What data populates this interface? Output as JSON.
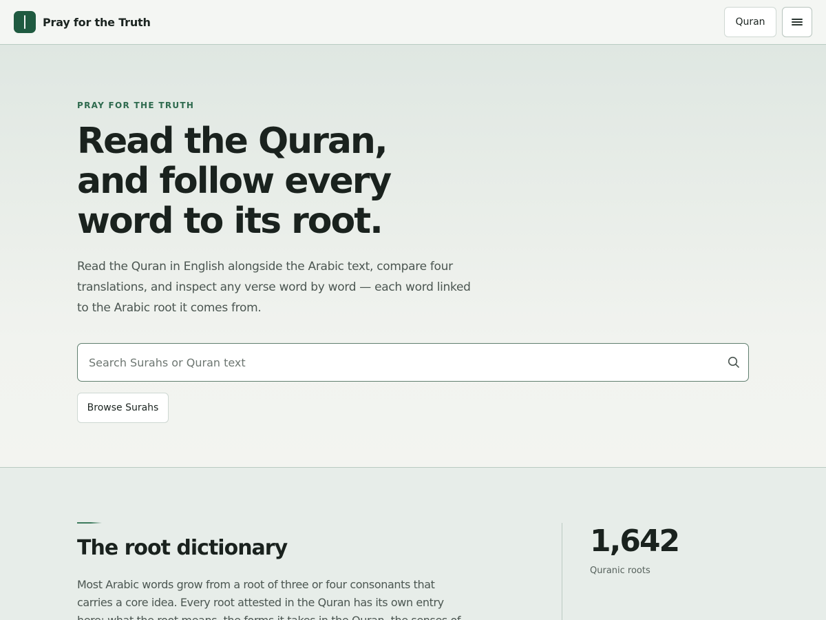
{
  "header": {
    "brand_name": "Pray for the Truth",
    "quran_label": "Quran",
    "menu_icon": "hamburger-menu-icon"
  },
  "hero": {
    "eyebrow": "PRAY FOR THE TRUTH",
    "title_lines": [
      "Read the Quran,",
      "and follow every",
      "word to its root."
    ],
    "description": "Read the Quran in English alongside the Arabic text, compare four translations, and inspect any verse word by word — each word linked to the Arabic root it comes from.",
    "search": {
      "placeholder": "Search Surahs or Quran text",
      "value": "",
      "icon": "search-icon"
    },
    "browse_label": "Browse Surahs"
  },
  "root_section": {
    "title": "The root dictionary",
    "description": "Most Arabic words grow from a root of three or four consonants that carries a core idea. Every root attested in the Quran has its own entry here: what the root means, the forms it takes in the Quran, the senses of",
    "stat": {
      "value": "1,642",
      "label": "Quranic roots"
    }
  },
  "colors": {
    "accent": "#1f5a40",
    "eyebrow": "#2e6a4e",
    "header_bg": "#f4f6f3",
    "page_bg": "#e7ede9"
  }
}
